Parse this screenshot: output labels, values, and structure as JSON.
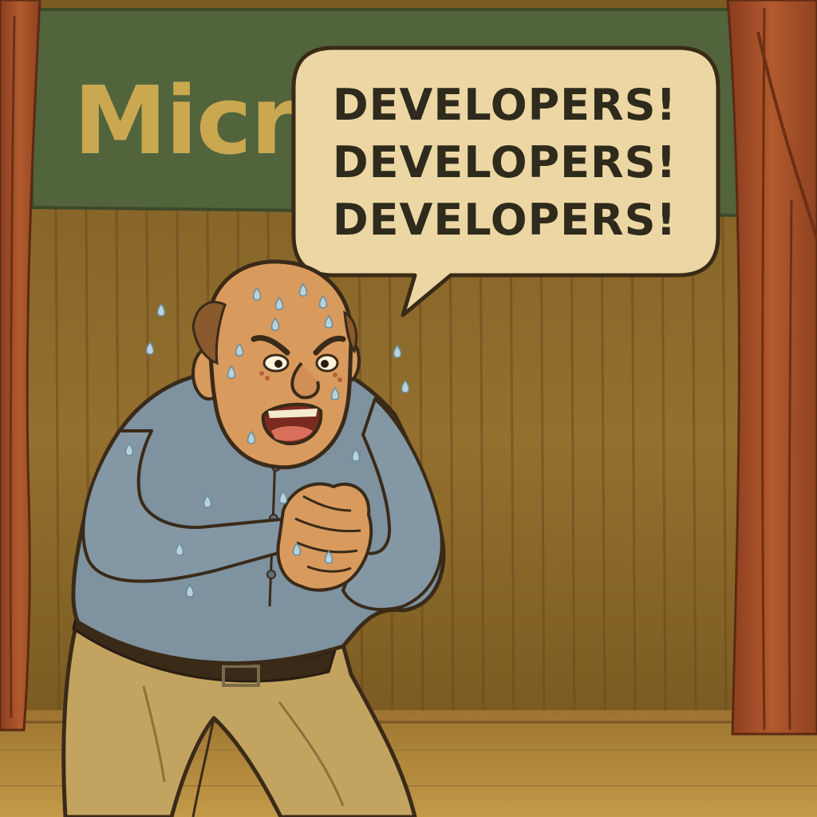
{
  "banner": {
    "text": "Micr"
  },
  "speech_bubble": {
    "lines": [
      "DEVELOPERS!",
      "DEVELOPERS!",
      "DEVELOPERS!"
    ]
  },
  "colors": {
    "stage_curtain": "#8e6a2c",
    "curtain_fold_dark": "#6f5020",
    "side_curtain": "#a8502a",
    "banner_bg": "#52643c",
    "banner_text": "#c9a850",
    "bubble_fill": "#ecd7a4",
    "bubble_text": "#2e2a1c",
    "outline": "#3a2a18",
    "skin": "#d99a5e",
    "shirt": "#7e92a0",
    "pants": "#c2a460",
    "belt": "#3a2a18",
    "floor": "#b58a3c",
    "sweat": "#b6d2dc"
  }
}
